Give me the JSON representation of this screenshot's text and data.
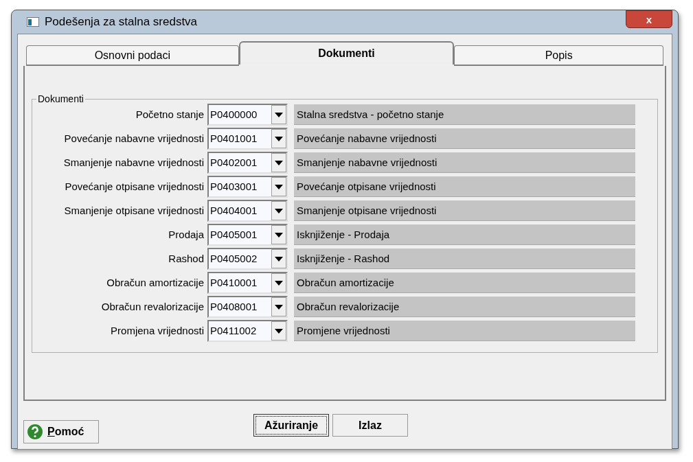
{
  "window": {
    "title": "Podešenja za stalna sredstva",
    "close": "x"
  },
  "tabs": [
    {
      "label": "Osnovni podaci",
      "selected": false
    },
    {
      "label": "Dokumenti",
      "selected": true
    },
    {
      "label": "Popis",
      "selected": false
    }
  ],
  "group": {
    "title": "Dokumenti",
    "rows": [
      {
        "label": "Početno stanje",
        "code": "P0400000",
        "description": "Stalna sredstva - početno stanje"
      },
      {
        "label": "Povećanje nabavne vrijednosti",
        "code": "P0401001",
        "description": "Povećanje nabavne vrijednosti"
      },
      {
        "label": "Smanjenje nabavne vrijednosti",
        "code": "P0402001",
        "description": "Smanjenje nabavne vrijednosti"
      },
      {
        "label": "Povećanje otpisane vrijednosti",
        "code": "P0403001",
        "description": "Povećanje otpisane vrijednosti"
      },
      {
        "label": "Smanjenje otpisane vrijednosti",
        "code": "P0404001",
        "description": "Smanjenje otpisane vrijednosti"
      },
      {
        "label": "Prodaja",
        "code": "P0405001",
        "description": "Isknjiženje - Prodaja"
      },
      {
        "label": "Rashod",
        "code": "P0405002",
        "description": "Isknjiženje - Rashod"
      },
      {
        "label": "Obračun amortizacije",
        "code": "P0410001",
        "description": "Obračun amortizacije"
      },
      {
        "label": "Obračun revalorizacije",
        "code": "P0408001",
        "description": "Obračun revalorizacije"
      },
      {
        "label": "Promjena vrijednosti",
        "code": "P0411002",
        "description": "Promjene vrijednosti"
      }
    ]
  },
  "buttons": {
    "help": "Pomoć",
    "update": "Ažuriranje",
    "exit": "Izlaz"
  }
}
